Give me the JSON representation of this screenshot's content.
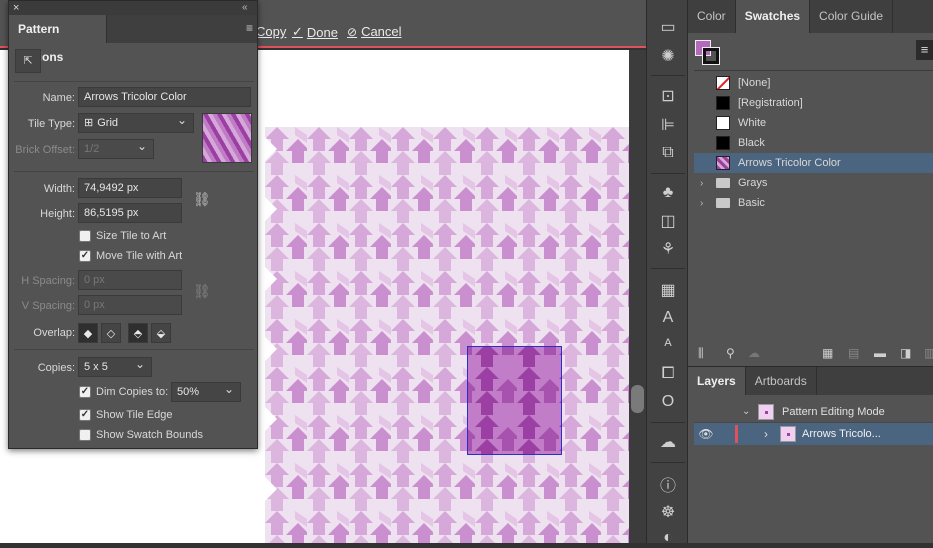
{
  "mode_bar": {
    "copy_label": "Copy",
    "done_label": "Done",
    "cancel_label": "Cancel"
  },
  "dialog": {
    "title": "Pattern Options",
    "name_label": "Name:",
    "name_value": "Arrows Tricolor Color",
    "tile_type_label": "Tile Type:",
    "tile_type_value": "Grid",
    "brick_offset_label": "Brick Offset:",
    "brick_offset_value": "1/2",
    "width_label": "Width:",
    "width_value": "74,9492 px",
    "height_label": "Height:",
    "height_value": "86,5195 px",
    "size_tile_label": "Size Tile to Art",
    "size_tile_checked": false,
    "move_tile_label": "Move Tile with Art",
    "move_tile_checked": true,
    "h_spacing_label": "H Spacing:",
    "h_spacing_value": "0 px",
    "v_spacing_label": "V Spacing:",
    "v_spacing_value": "0 px",
    "overlap_label": "Overlap:",
    "copies_label": "Copies:",
    "copies_value": "5 x 5",
    "dim_copies_label": "Dim Copies to:",
    "dim_copies_checked": true,
    "dim_copies_value": "50%",
    "show_tile_edge_label": "Show Tile Edge",
    "show_tile_edge_checked": true,
    "show_swatch_bounds_label": "Show Swatch Bounds",
    "show_swatch_bounds_checked": false
  },
  "swatches_panel": {
    "tabs": [
      "Color",
      "Swatches",
      "Color Guide"
    ],
    "active_tab": "Swatches",
    "items": [
      {
        "label": "[None]",
        "kind": "none"
      },
      {
        "label": "[Registration]",
        "kind": "registration"
      },
      {
        "label": "White",
        "kind": "white"
      },
      {
        "label": "Black",
        "kind": "black"
      },
      {
        "label": "Arrows Tricolor Color",
        "kind": "pattern",
        "selected": true
      },
      {
        "label": "Grays",
        "kind": "folder"
      },
      {
        "label": "Basic",
        "kind": "folder"
      }
    ]
  },
  "layers_panel": {
    "tabs": [
      "Layers",
      "Artboards"
    ],
    "active_tab": "Layers",
    "rows": [
      {
        "label": "Pattern Editing Mode"
      },
      {
        "label": "Arrows Tricolo..."
      }
    ]
  },
  "colors": {
    "pattern_light": "#d9b3dd",
    "pattern_mid": "#c07dc5",
    "pattern_dark": "#9b3fa3",
    "tile_edge": "#2d2dc8",
    "selection": "#4b6480",
    "mode_bar_accent": "#e0525b"
  }
}
